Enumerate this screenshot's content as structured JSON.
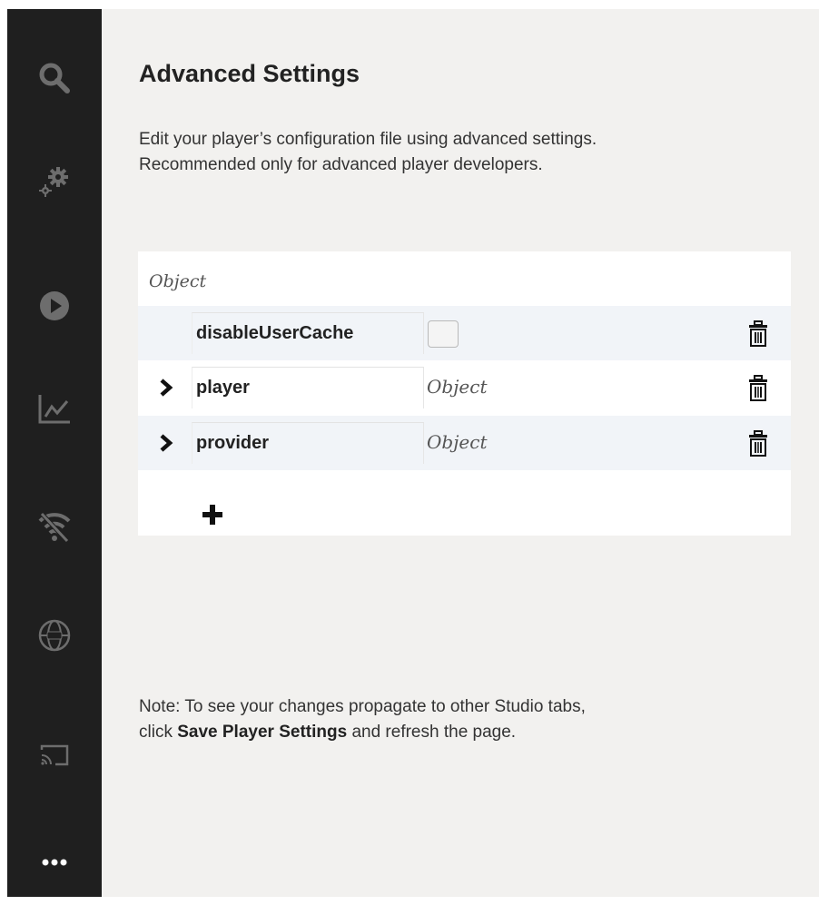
{
  "sidebar": {
    "items": [
      {
        "icon": "search-icon"
      },
      {
        "icon": "gears-icon"
      },
      {
        "icon": "play-icon"
      },
      {
        "icon": "analytics-icon"
      },
      {
        "icon": "wifi-off-icon"
      },
      {
        "icon": "globe-360-icon"
      },
      {
        "icon": "cast-icon"
      },
      {
        "icon": "more-icon"
      }
    ]
  },
  "main": {
    "title": "Advanced Settings",
    "description_line1": "Edit your player’s configuration file using advanced settings.",
    "description_line2": "Recommended only for advanced player developers.",
    "editor": {
      "root_type": "Object",
      "rows": [
        {
          "key": "disableUserCache",
          "value_type": "checkbox",
          "checked": false
        },
        {
          "key": "player",
          "value_type": "Object",
          "expandable": true
        },
        {
          "key": "provider",
          "value_type": "Object",
          "expandable": true
        }
      ]
    },
    "note": {
      "prefix": "Note: To see your changes propagate to other Studio tabs,",
      "click": "click ",
      "bold": "Save Player Settings",
      "suffix": " and refresh the page."
    }
  }
}
